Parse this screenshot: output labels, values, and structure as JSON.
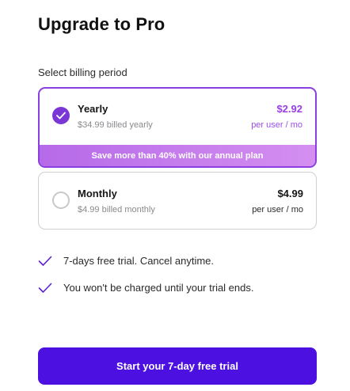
{
  "title": "Upgrade to Pro",
  "billing": {
    "label": "Select billing period",
    "selected": "yearly",
    "plans": [
      {
        "id": "yearly",
        "name": "Yearly",
        "billed": "$34.99 billed yearly",
        "price": "$2.92",
        "unit": "per user / mo",
        "banner": "Save more than 40% with our annual plan"
      },
      {
        "id": "monthly",
        "name": "Monthly",
        "billed": "$4.99 billed monthly",
        "price": "$4.99",
        "unit": "per user / mo"
      }
    ]
  },
  "features": [
    "7-days free trial. Cancel anytime.",
    "You won't be charged until your trial ends."
  ],
  "cta": {
    "label": "Start your 7-day free trial"
  },
  "colors": {
    "accent": "#8b3fe0",
    "cta": "#4c10e0",
    "banner_start": "#b66ae8",
    "banner_end": "#d48ff0"
  },
  "icons": {
    "selected_radio": "check-icon",
    "feature": "check-icon"
  }
}
